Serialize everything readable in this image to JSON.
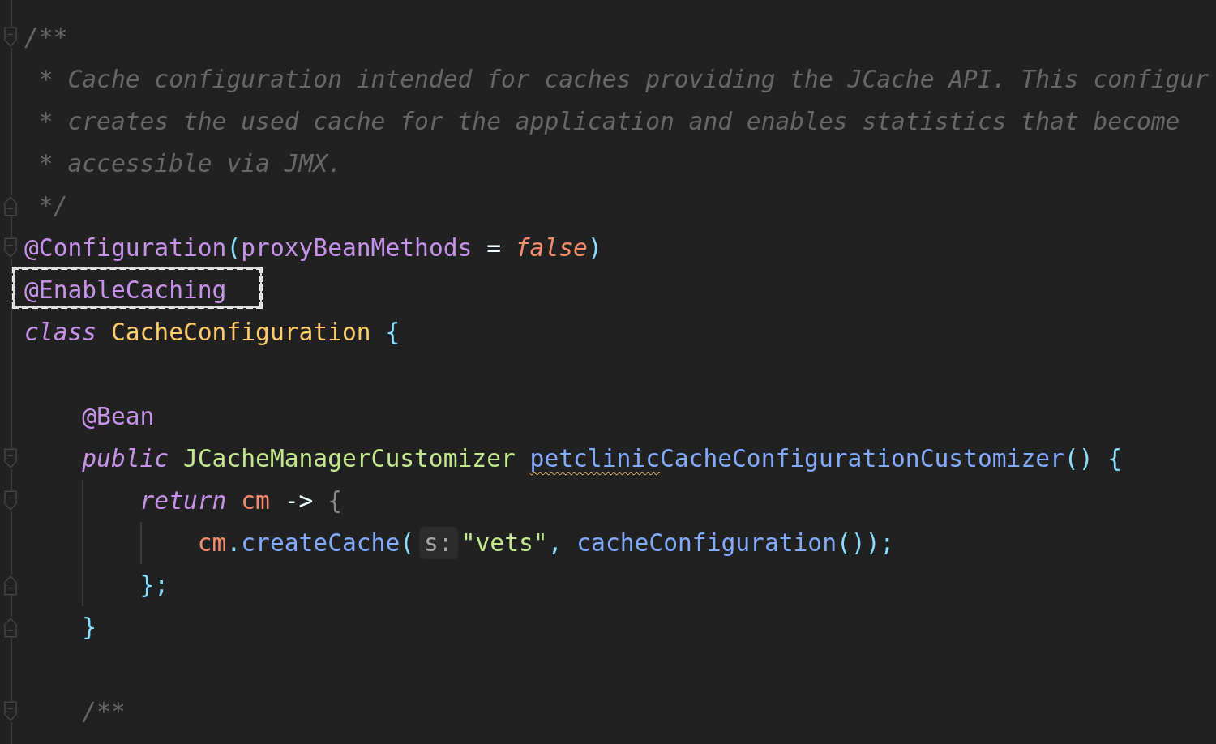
{
  "editor": {
    "blocks": [
      [
        {
          "fold_start": true,
          "fold_end": false,
          "segments": [
            {
              "kind": "code",
              "tokens": [
                {
                  "kind": "comment",
                  "text": "/**"
                }
              ]
            }
          ]
        },
        {
          "fold_start": false,
          "fold_end": false,
          "segments": [
            {
              "kind": "code",
              "tokens": [
                {
                  "kind": "comment",
                  "text": " * Cache configuration intended for caches providing the JCache API. This configur"
                }
              ]
            }
          ]
        },
        {
          "fold_start": false,
          "fold_end": false,
          "segments": [
            {
              "kind": "code",
              "tokens": [
                {
                  "kind": "comment",
                  "text": " * creates the used cache for the application and enables statistics that become"
                }
              ]
            }
          ]
        },
        {
          "fold_start": false,
          "fold_end": false,
          "segments": [
            {
              "kind": "code",
              "tokens": [
                {
                  "kind": "comment",
                  "text": " * accessible via JMX."
                }
              ]
            }
          ]
        },
        {
          "fold_start": false,
          "fold_end": true,
          "segments": [
            {
              "kind": "code",
              "tokens": [
                {
                  "kind": "comment",
                  "text": " */"
                }
              ]
            }
          ]
        },
        {
          "fold_start": true,
          "fold_end": false,
          "segments": [
            {
              "kind": "code",
              "tokens": [
                {
                  "kind": "annotation",
                  "text": "@Configuration"
                },
                {
                  "kind": "punct",
                  "text": "("
                },
                {
                  "kind": "annotation",
                  "text": "proxyBeanMethods"
                },
                {
                  "kind": "operator",
                  "text": " = "
                },
                {
                  "kind": "literal",
                  "text": "false"
                },
                {
                  "kind": "punct",
                  "text": ")"
                }
              ]
            }
          ]
        },
        {
          "fold_start": false,
          "fold_end": false,
          "segments": [
            {
              "kind": "code",
              "boxed": true,
              "tokens": [
                {
                  "kind": "annotation",
                  "text": "@EnableCaching"
                }
              ]
            }
          ]
        },
        {
          "fold_start": false,
          "fold_end": false,
          "segments": [
            {
              "kind": "code",
              "tokens": [
                {
                  "kind": "keyword",
                  "text": "class "
                },
                {
                  "kind": "class",
                  "text": "CacheConfiguration "
                },
                {
                  "kind": "punct",
                  "text": "{"
                }
              ]
            }
          ]
        }
      ],
      [
        {
          "fold_start": false,
          "fold_end": false,
          "segments": [
            {
              "kind": "code",
              "tokens": [
                {
                  "kind": "annotation",
                  "text": "    @Bean"
                }
              ]
            }
          ]
        },
        {
          "fold_start": true,
          "fold_end": false,
          "segments": [
            {
              "kind": "code",
              "tokens": [
                {
                  "kind": "keyword",
                  "text": "    public "
                },
                {
                  "kind": "type",
                  "text": "JCacheManagerCustomizer "
                },
                {
                  "kind": "method",
                  "text": "petclinic",
                  "typo": true
                },
                {
                  "kind": "method",
                  "text": "CacheConfigurationCustomizer"
                },
                {
                  "kind": "punct",
                  "text": "() {"
                }
              ]
            }
          ]
        },
        {
          "fold_start": true,
          "fold_end": false,
          "segments": [
            {
              "kind": "code",
              "tokens": [
                {
                  "kind": "keyword",
                  "text": "        return "
                },
                {
                  "kind": "variable",
                  "text": "cm"
                },
                {
                  "kind": "operator",
                  "text": " -> "
                },
                {
                  "kind": "dim",
                  "text": "{"
                }
              ]
            }
          ]
        },
        {
          "fold_start": false,
          "fold_end": false,
          "segments": [
            {
              "kind": "code",
              "tokens": [
                {
                  "kind": "variable",
                  "text": "            cm"
                },
                {
                  "kind": "punct",
                  "text": "."
                },
                {
                  "kind": "method",
                  "text": "createCache"
                },
                {
                  "kind": "punct",
                  "text": "("
                }
              ]
            },
            {
              "kind": "hint",
              "text": "s:"
            },
            {
              "kind": "code",
              "tokens": [
                {
                  "kind": "string",
                  "text": "\"vets\""
                },
                {
                  "kind": "punct",
                  "text": ", "
                },
                {
                  "kind": "method",
                  "text": "cacheConfiguration"
                },
                {
                  "kind": "punct",
                  "text": "());"
                }
              ]
            }
          ]
        },
        {
          "fold_start": false,
          "fold_end": true,
          "segments": [
            {
              "kind": "code",
              "tokens": [
                {
                  "kind": "punct",
                  "text": "        };"
                }
              ]
            }
          ]
        },
        {
          "fold_start": false,
          "fold_end": true,
          "segments": [
            {
              "kind": "code",
              "tokens": [
                {
                  "kind": "punct",
                  "text": "    }"
                }
              ]
            }
          ]
        }
      ],
      [
        {
          "fold_start": true,
          "fold_end": false,
          "segments": [
            {
              "kind": "code",
              "tokens": [
                {
                  "kind": "comment",
                  "text": "    /**"
                }
              ]
            }
          ]
        }
      ]
    ]
  }
}
